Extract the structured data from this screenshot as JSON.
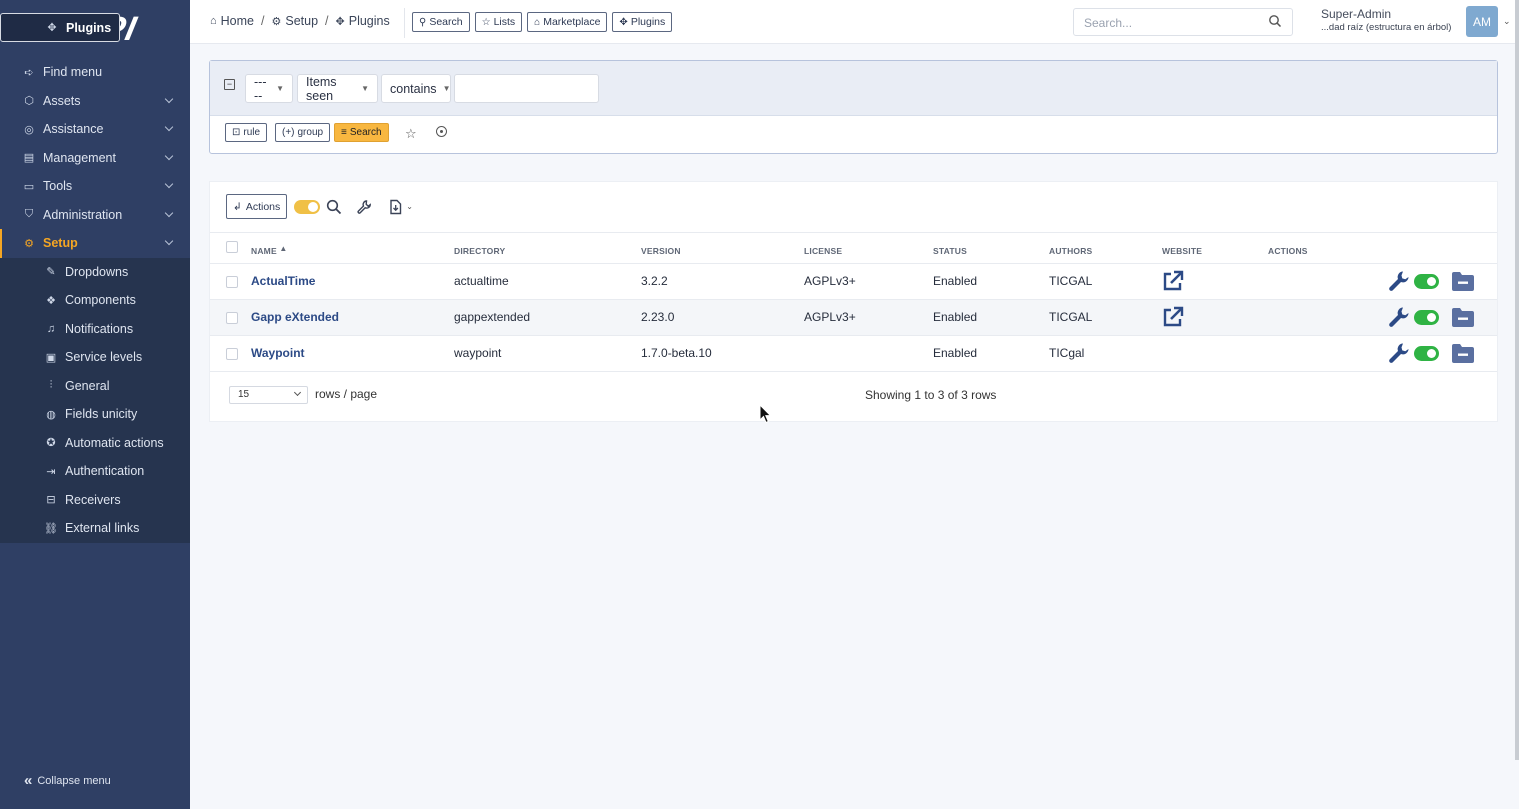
{
  "sidebar": {
    "logo": "GLPI",
    "items": [
      {
        "label": "Find menu",
        "icon": "arrow-right-icon",
        "chevron": false
      },
      {
        "label": "Assets",
        "icon": "cube-icon",
        "chevron": true
      },
      {
        "label": "Assistance",
        "icon": "headset-icon",
        "chevron": true
      },
      {
        "label": "Management",
        "icon": "wallet-icon",
        "chevron": true
      },
      {
        "label": "Tools",
        "icon": "briefcase-icon",
        "chevron": true
      },
      {
        "label": "Administration",
        "icon": "shield-icon",
        "chevron": true
      },
      {
        "label": "Setup",
        "icon": "gear-icon",
        "chevron": true,
        "active": true
      }
    ],
    "subitems": [
      {
        "label": "Dropdowns",
        "icon": "edit-icon"
      },
      {
        "label": "Components",
        "icon": "components-icon"
      },
      {
        "label": "Notifications",
        "icon": "bell-icon"
      },
      {
        "label": "Service levels",
        "icon": "clipboard-check-icon"
      },
      {
        "label": "General",
        "icon": "adjustments-icon"
      },
      {
        "label": "Fields unicity",
        "icon": "fingerprint-icon"
      },
      {
        "label": "Automatic actions",
        "icon": "settings-automation-icon"
      },
      {
        "label": "Authentication",
        "icon": "login-icon"
      },
      {
        "label": "Receivers",
        "icon": "inbox-icon"
      },
      {
        "label": "External links",
        "icon": "link-icon"
      },
      {
        "label": "Plugins",
        "icon": "puzzle-icon",
        "selected": true
      }
    ],
    "collapse_label": "Collapse menu"
  },
  "topbar": {
    "breadcrumb": [
      "Home",
      "Setup",
      "Plugins"
    ],
    "buttons": [
      "Search",
      "Lists",
      "Marketplace",
      "Plugins"
    ],
    "search_placeholder": "Search...",
    "user_name": "Super-Admin",
    "user_entity": "...dad raíz (estructura en árbol)",
    "avatar_initials": "AM"
  },
  "search_panel": {
    "field_select": "-----",
    "criteria_select": "Items seen",
    "operator_select": "contains",
    "value": "",
    "rule_button": "rule",
    "group_button": "group",
    "search_button": "Search"
  },
  "table": {
    "actions_label": "Actions",
    "columns": [
      "NAME",
      "DIRECTORY",
      "VERSION",
      "LICENSE",
      "STATUS",
      "AUTHORS",
      "WEBSITE",
      "ACTIONS"
    ],
    "rows": [
      {
        "name": "ActualTime",
        "directory": "actualtime",
        "version": "3.2.2",
        "license": "AGPLv3+",
        "status": "Enabled",
        "authors": "TICGAL",
        "website": true
      },
      {
        "name": "Gapp eXtended",
        "directory": "gappextended",
        "version": "2.23.0",
        "license": "AGPLv3+",
        "status": "Enabled",
        "authors": "TICGAL",
        "website": true
      },
      {
        "name": "Waypoint",
        "directory": "waypoint",
        "version": "1.7.0-beta.10",
        "license": "",
        "status": "Enabled",
        "authors": "TICgal",
        "website": false
      }
    ],
    "rows_per_page": "15",
    "rows_per_page_label": "rows / page",
    "showing": "Showing 1 to 3 of 3 rows"
  },
  "colors": {
    "sidebar_bg": "#2f3f64",
    "accent": "#f5a623",
    "link": "#2c4a86",
    "enabled_toggle": "#2fb344"
  }
}
